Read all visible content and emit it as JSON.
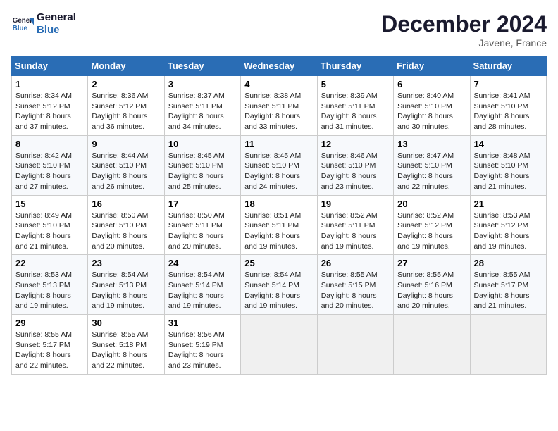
{
  "header": {
    "logo_line1": "General",
    "logo_line2": "Blue",
    "month_title": "December 2024",
    "location": "Javene, France"
  },
  "weekdays": [
    "Sunday",
    "Monday",
    "Tuesday",
    "Wednesday",
    "Thursday",
    "Friday",
    "Saturday"
  ],
  "weeks": [
    [
      {
        "day": "1",
        "rise": "Sunrise: 8:34 AM",
        "set": "Sunset: 5:12 PM",
        "daylight": "Daylight: 8 hours and 37 minutes."
      },
      {
        "day": "2",
        "rise": "Sunrise: 8:36 AM",
        "set": "Sunset: 5:12 PM",
        "daylight": "Daylight: 8 hours and 36 minutes."
      },
      {
        "day": "3",
        "rise": "Sunrise: 8:37 AM",
        "set": "Sunset: 5:11 PM",
        "daylight": "Daylight: 8 hours and 34 minutes."
      },
      {
        "day": "4",
        "rise": "Sunrise: 8:38 AM",
        "set": "Sunset: 5:11 PM",
        "daylight": "Daylight: 8 hours and 33 minutes."
      },
      {
        "day": "5",
        "rise": "Sunrise: 8:39 AM",
        "set": "Sunset: 5:11 PM",
        "daylight": "Daylight: 8 hours and 31 minutes."
      },
      {
        "day": "6",
        "rise": "Sunrise: 8:40 AM",
        "set": "Sunset: 5:10 PM",
        "daylight": "Daylight: 8 hours and 30 minutes."
      },
      {
        "day": "7",
        "rise": "Sunrise: 8:41 AM",
        "set": "Sunset: 5:10 PM",
        "daylight": "Daylight: 8 hours and 28 minutes."
      }
    ],
    [
      {
        "day": "8",
        "rise": "Sunrise: 8:42 AM",
        "set": "Sunset: 5:10 PM",
        "daylight": "Daylight: 8 hours and 27 minutes."
      },
      {
        "day": "9",
        "rise": "Sunrise: 8:44 AM",
        "set": "Sunset: 5:10 PM",
        "daylight": "Daylight: 8 hours and 26 minutes."
      },
      {
        "day": "10",
        "rise": "Sunrise: 8:45 AM",
        "set": "Sunset: 5:10 PM",
        "daylight": "Daylight: 8 hours and 25 minutes."
      },
      {
        "day": "11",
        "rise": "Sunrise: 8:45 AM",
        "set": "Sunset: 5:10 PM",
        "daylight": "Daylight: 8 hours and 24 minutes."
      },
      {
        "day": "12",
        "rise": "Sunrise: 8:46 AM",
        "set": "Sunset: 5:10 PM",
        "daylight": "Daylight: 8 hours and 23 minutes."
      },
      {
        "day": "13",
        "rise": "Sunrise: 8:47 AM",
        "set": "Sunset: 5:10 PM",
        "daylight": "Daylight: 8 hours and 22 minutes."
      },
      {
        "day": "14",
        "rise": "Sunrise: 8:48 AM",
        "set": "Sunset: 5:10 PM",
        "daylight": "Daylight: 8 hours and 21 minutes."
      }
    ],
    [
      {
        "day": "15",
        "rise": "Sunrise: 8:49 AM",
        "set": "Sunset: 5:10 PM",
        "daylight": "Daylight: 8 hours and 21 minutes."
      },
      {
        "day": "16",
        "rise": "Sunrise: 8:50 AM",
        "set": "Sunset: 5:10 PM",
        "daylight": "Daylight: 8 hours and 20 minutes."
      },
      {
        "day": "17",
        "rise": "Sunrise: 8:50 AM",
        "set": "Sunset: 5:11 PM",
        "daylight": "Daylight: 8 hours and 20 minutes."
      },
      {
        "day": "18",
        "rise": "Sunrise: 8:51 AM",
        "set": "Sunset: 5:11 PM",
        "daylight": "Daylight: 8 hours and 19 minutes."
      },
      {
        "day": "19",
        "rise": "Sunrise: 8:52 AM",
        "set": "Sunset: 5:11 PM",
        "daylight": "Daylight: 8 hours and 19 minutes."
      },
      {
        "day": "20",
        "rise": "Sunrise: 8:52 AM",
        "set": "Sunset: 5:12 PM",
        "daylight": "Daylight: 8 hours and 19 minutes."
      },
      {
        "day": "21",
        "rise": "Sunrise: 8:53 AM",
        "set": "Sunset: 5:12 PM",
        "daylight": "Daylight: 8 hours and 19 minutes."
      }
    ],
    [
      {
        "day": "22",
        "rise": "Sunrise: 8:53 AM",
        "set": "Sunset: 5:13 PM",
        "daylight": "Daylight: 8 hours and 19 minutes."
      },
      {
        "day": "23",
        "rise": "Sunrise: 8:54 AM",
        "set": "Sunset: 5:13 PM",
        "daylight": "Daylight: 8 hours and 19 minutes."
      },
      {
        "day": "24",
        "rise": "Sunrise: 8:54 AM",
        "set": "Sunset: 5:14 PM",
        "daylight": "Daylight: 8 hours and 19 minutes."
      },
      {
        "day": "25",
        "rise": "Sunrise: 8:54 AM",
        "set": "Sunset: 5:14 PM",
        "daylight": "Daylight: 8 hours and 19 minutes."
      },
      {
        "day": "26",
        "rise": "Sunrise: 8:55 AM",
        "set": "Sunset: 5:15 PM",
        "daylight": "Daylight: 8 hours and 20 minutes."
      },
      {
        "day": "27",
        "rise": "Sunrise: 8:55 AM",
        "set": "Sunset: 5:16 PM",
        "daylight": "Daylight: 8 hours and 20 minutes."
      },
      {
        "day": "28",
        "rise": "Sunrise: 8:55 AM",
        "set": "Sunset: 5:17 PM",
        "daylight": "Daylight: 8 hours and 21 minutes."
      }
    ],
    [
      {
        "day": "29",
        "rise": "Sunrise: 8:55 AM",
        "set": "Sunset: 5:17 PM",
        "daylight": "Daylight: 8 hours and 22 minutes."
      },
      {
        "day": "30",
        "rise": "Sunrise: 8:55 AM",
        "set": "Sunset: 5:18 PM",
        "daylight": "Daylight: 8 hours and 22 minutes."
      },
      {
        "day": "31",
        "rise": "Sunrise: 8:56 AM",
        "set": "Sunset: 5:19 PM",
        "daylight": "Daylight: 8 hours and 23 minutes."
      },
      null,
      null,
      null,
      null
    ]
  ]
}
